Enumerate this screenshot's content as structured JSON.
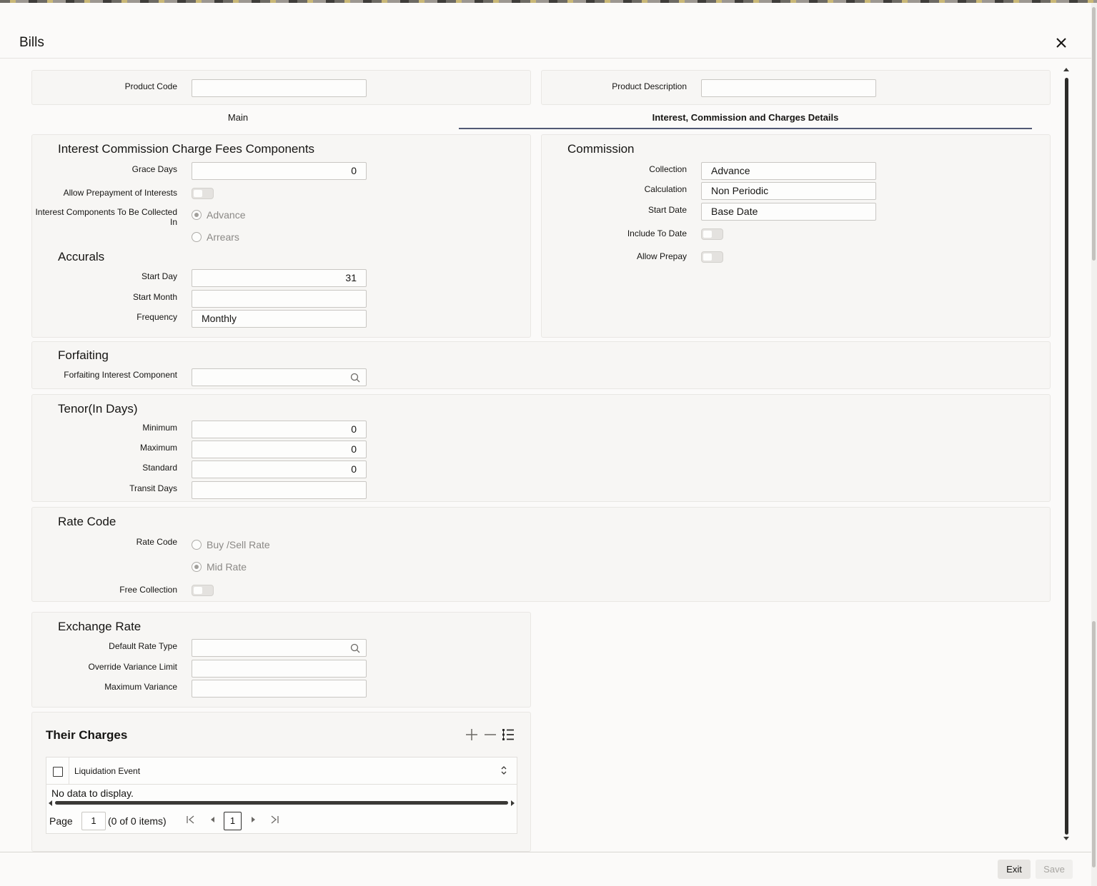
{
  "window": {
    "title": "Bills"
  },
  "header": {
    "product_code_label": "Product Code",
    "product_code_value": "",
    "product_description_label": "Product Description",
    "product_description_value": ""
  },
  "tabs": [
    {
      "label": "Main",
      "active": false
    },
    {
      "label": "Interest, Commission and Charges Details",
      "active": true
    }
  ],
  "icfc": {
    "title": "Interest Commission Charge Fees Components",
    "grace_days_label": "Grace Days",
    "grace_days_value": "0",
    "allow_prepayment_label": "Allow Prepayment of Interests",
    "allow_prepayment_on": false,
    "collected_in_label": "Interest Components To Be Collected In",
    "options": [
      {
        "label": "Advance",
        "selected": true
      },
      {
        "label": "Arrears",
        "selected": false
      }
    ]
  },
  "accruals": {
    "title": "Accurals",
    "start_day_label": "Start Day",
    "start_day_value": "31",
    "start_month_label": "Start Month",
    "start_month_value": "",
    "frequency_label": "Frequency",
    "frequency_value": "Monthly"
  },
  "commission": {
    "title": "Commission",
    "collection_label": "Collection",
    "collection_value": "Advance",
    "calculation_label": "Calculation",
    "calculation_value": "Non Periodic",
    "start_date_label": "Start Date",
    "start_date_value": "Base Date",
    "include_to_date_label": "Include To Date",
    "include_to_date_on": false,
    "allow_prepay_label": "Allow Prepay",
    "allow_prepay_on": false
  },
  "forfaiting": {
    "title": "Forfaiting",
    "interest_component_label": "Forfaiting Interest Component",
    "interest_component_value": ""
  },
  "tenor": {
    "title": "Tenor(In Days)",
    "minimum_label": "Minimum",
    "minimum_value": "0",
    "maximum_label": "Maximum",
    "maximum_value": "0",
    "standard_label": "Standard",
    "standard_value": "0",
    "transit_days_label": "Transit Days",
    "transit_days_value": ""
  },
  "rate_code": {
    "title": "Rate Code",
    "rate_code_label": "Rate Code",
    "options": [
      {
        "label": "Buy /Sell Rate",
        "selected": false
      },
      {
        "label": "Mid Rate",
        "selected": true
      }
    ],
    "free_collection_label": "Free Collection",
    "free_collection_on": false
  },
  "exchange_rate": {
    "title": "Exchange Rate",
    "default_rate_type_label": "Default Rate Type",
    "default_rate_type_value": "",
    "override_variance_label": "Override Variance Limit",
    "override_variance_value": "",
    "maximum_variance_label": "Maximum Variance",
    "maximum_variance_value": ""
  },
  "their_charges": {
    "title": "Their Charges",
    "column": "Liquidation Event",
    "empty_text": "No data to display.",
    "page_label": "Page",
    "page_value": "1",
    "items_text": "(0 of 0 items)",
    "current_page": "1"
  },
  "footer": {
    "exit_label": "Exit",
    "save_label": "Save"
  },
  "colors": {
    "tab_underline": "#525975",
    "accent_text": "#161513",
    "disabled_text": "#8b8986"
  }
}
